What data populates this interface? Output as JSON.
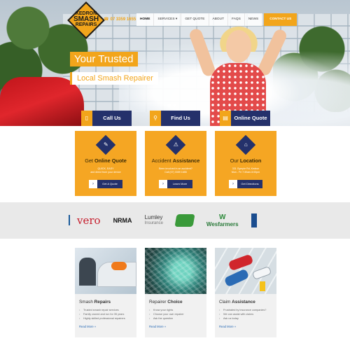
{
  "logo": {
    "line1": "KEDRON",
    "line2": "SMASH",
    "line3": "REPAIRS"
  },
  "header": {
    "phone": "07 3359 1655",
    "nav": [
      "HOME",
      "SERVICES",
      "GET QUOTE",
      "ABOUT",
      "FAQS",
      "NEWS"
    ],
    "cta": "CONTACT US"
  },
  "hero": {
    "title": "Your Trusted",
    "subtitle": "Local Smash Repairer",
    "buttons": [
      {
        "label": "Call Us",
        "icon": "phone-icon"
      },
      {
        "label": "Find Us",
        "icon": "map-pin-icon"
      },
      {
        "label": "Online Quote",
        "icon": "document-icon"
      }
    ]
  },
  "services": [
    {
      "title_pre": "Get ",
      "title_bold": "Online Quote",
      "text": "QUICK, EASY\nand direct from your device",
      "button": "Get A Quote",
      "icon": "quote-icon"
    },
    {
      "title_pre": "Accident ",
      "title_bold": "Assistance",
      "text": "Been involved in an accident?\nCall (07) 3359 1655",
      "button": "Learn More",
      "icon": "accident-icon"
    },
    {
      "title_pre": "Our ",
      "title_bold": "Location",
      "text": "331 Gympie Rd, Kedron\nMon - Fri 7:30am-5:00pm",
      "button": "Get Directions",
      "icon": "location-icon"
    }
  ],
  "partners": [
    "vero",
    "NRMA",
    "Lumley",
    "Insurance",
    "Wesfarmers"
  ],
  "info_cards": [
    {
      "title_pre": "Smash ",
      "title_bold": "Repairs",
      "items": [
        "Trusted smash repair services",
        "Family owned and run for 35 years",
        "Highly skilled professional repairers"
      ],
      "link": "Read More »"
    },
    {
      "title_pre": "Repairer ",
      "title_bold": "Choice",
      "items": [
        "Know your rights",
        "Choose your own repairer",
        "Ask the question"
      ],
      "link": "Read More »"
    },
    {
      "title_pre": "Claim ",
      "title_bold": "Assistance",
      "items": [
        "Frustrated by insurance companies?",
        "We can assist with claims",
        "Ask us today"
      ],
      "link": "Read More »"
    }
  ],
  "colors": {
    "accent": "#f2a51b",
    "navy": "#24316b"
  }
}
